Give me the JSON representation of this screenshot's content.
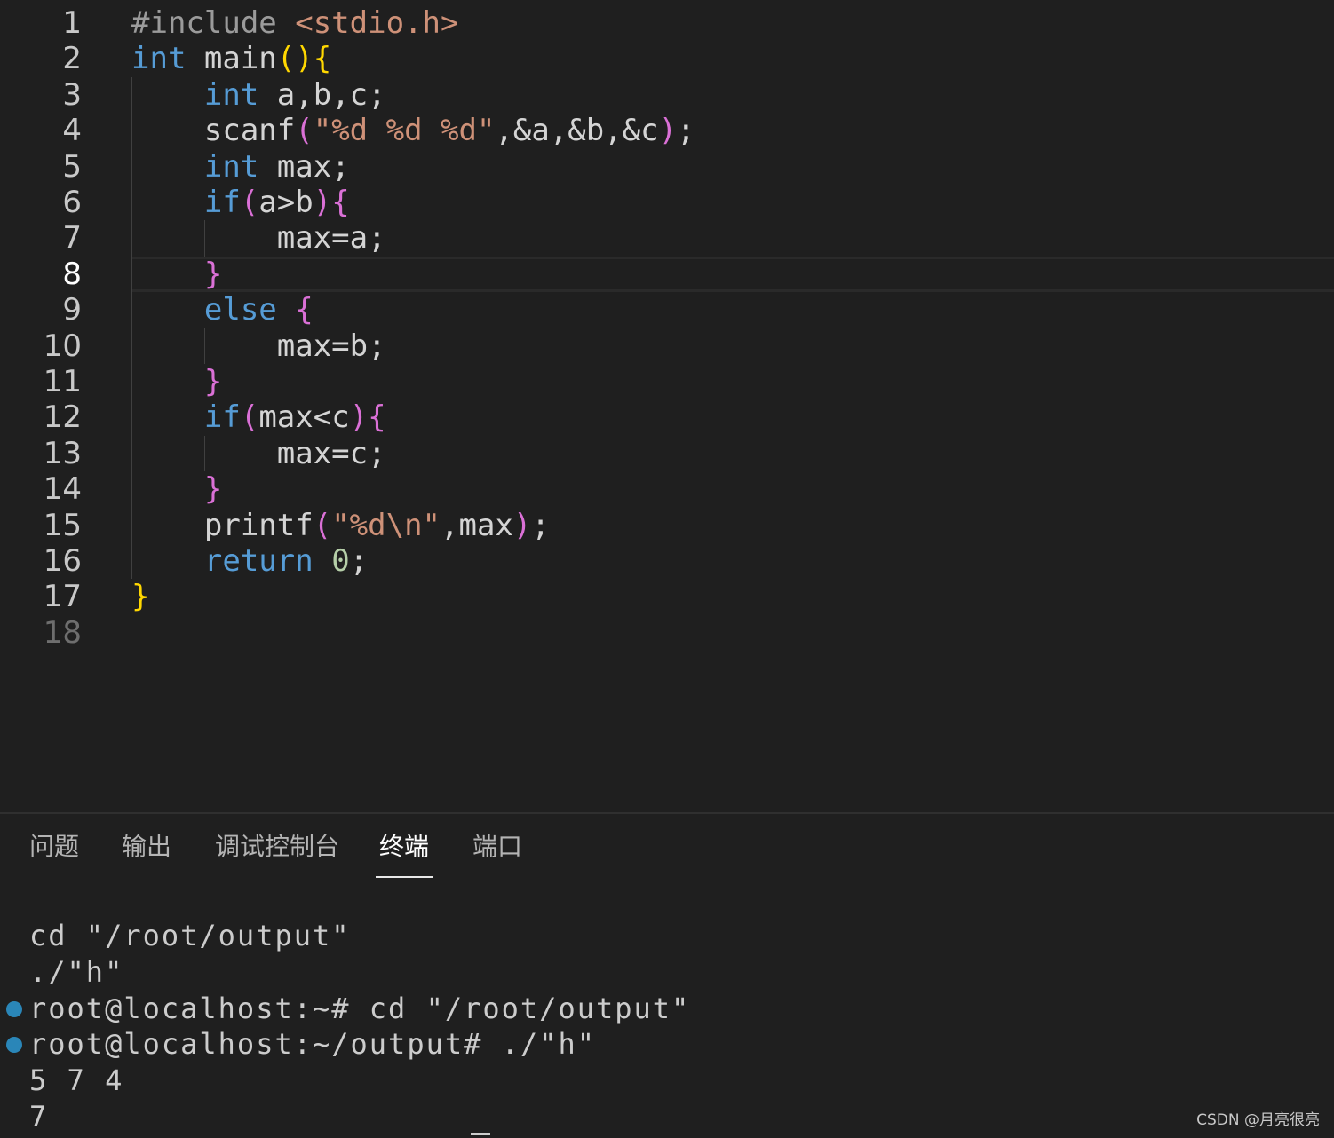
{
  "editor": {
    "lines": [
      {
        "num": "1",
        "tokens": [
          [
            "#include ",
            "pre"
          ],
          [
            "<stdio.h>",
            "str"
          ]
        ]
      },
      {
        "num": "2",
        "tokens": [
          [
            "int",
            "kw"
          ],
          [
            " main",
            "txt"
          ],
          [
            "()",
            "gold"
          ],
          [
            "{",
            "gold"
          ]
        ]
      },
      {
        "num": "3",
        "tokens": [
          [
            "    ",
            "txt"
          ],
          [
            "int",
            "kw"
          ],
          [
            " a,b,c;",
            "txt"
          ]
        ]
      },
      {
        "num": "4",
        "tokens": [
          [
            "    scanf",
            "txt"
          ],
          [
            "(",
            "pink"
          ],
          [
            "\"%d %d %d\"",
            "str"
          ],
          [
            ",&a,&b,&c",
            "txt"
          ],
          [
            ")",
            "pink"
          ],
          [
            ";",
            "txt"
          ]
        ]
      },
      {
        "num": "5",
        "tokens": [
          [
            "    ",
            "txt"
          ],
          [
            "int",
            "kw"
          ],
          [
            " max;",
            "txt"
          ]
        ]
      },
      {
        "num": "6",
        "tokens": [
          [
            "    ",
            "txt"
          ],
          [
            "if",
            "kw"
          ],
          [
            "(",
            "pink"
          ],
          [
            "a>b",
            "txt"
          ],
          [
            ")",
            "pink"
          ],
          [
            "{",
            "pink"
          ]
        ]
      },
      {
        "num": "7",
        "tokens": [
          [
            "        max=a;",
            "txt"
          ]
        ]
      },
      {
        "num": "8",
        "tokens": [
          [
            "    ",
            "txt"
          ],
          [
            "}",
            "pink"
          ]
        ]
      },
      {
        "num": "9",
        "tokens": [
          [
            "    ",
            "txt"
          ],
          [
            "else",
            "kw"
          ],
          [
            " ",
            "txt"
          ],
          [
            "{",
            "pink"
          ]
        ]
      },
      {
        "num": "10",
        "tokens": [
          [
            "        max=b;",
            "txt"
          ]
        ]
      },
      {
        "num": "11",
        "tokens": [
          [
            "    ",
            "txt"
          ],
          [
            "}",
            "pink"
          ]
        ]
      },
      {
        "num": "12",
        "tokens": [
          [
            "    ",
            "txt"
          ],
          [
            "if",
            "kw"
          ],
          [
            "(",
            "pink"
          ],
          [
            "max<c",
            "txt"
          ],
          [
            ")",
            "pink"
          ],
          [
            "{",
            "pink"
          ]
        ]
      },
      {
        "num": "13",
        "tokens": [
          [
            "        max=c;",
            "txt"
          ]
        ]
      },
      {
        "num": "14",
        "tokens": [
          [
            "    ",
            "txt"
          ],
          [
            "}",
            "pink"
          ]
        ]
      },
      {
        "num": "15",
        "tokens": [
          [
            "    printf",
            "txt"
          ],
          [
            "(",
            "pink"
          ],
          [
            "\"%d\\n\"",
            "str"
          ],
          [
            ",max",
            "txt"
          ],
          [
            ")",
            "pink"
          ],
          [
            ";",
            "txt"
          ]
        ]
      },
      {
        "num": "16",
        "tokens": [
          [
            "    ",
            "txt"
          ],
          [
            "return",
            "kw"
          ],
          [
            " ",
            "txt"
          ],
          [
            "0",
            "num"
          ],
          [
            ";",
            "txt"
          ]
        ]
      },
      {
        "num": "17",
        "tokens": [
          [
            "}",
            "gold"
          ]
        ]
      },
      {
        "num": "18",
        "tokens": []
      }
    ],
    "current_line": "8"
  },
  "panel": {
    "tabs": [
      {
        "label": "问题"
      },
      {
        "label": "输出"
      },
      {
        "label": "调试控制台"
      },
      {
        "label": "终端",
        "active": true
      },
      {
        "label": "端口"
      }
    ],
    "terminal": [
      {
        "text": "cd \"/root/output\"",
        "dot": false
      },
      {
        "text": "./\"h\"",
        "dot": false
      },
      {
        "text": "root@localhost:~# cd \"/root/output\"",
        "dot": true
      },
      {
        "text": "root@localhost:~/output# ./\"h\"",
        "dot": true
      },
      {
        "text": "5 7 4",
        "dot": false
      },
      {
        "text": "7",
        "dot": false
      }
    ]
  },
  "watermark": "CSDN @月亮很亮",
  "colors": {
    "background": "#1f1f1f",
    "keyword": "#569cd6",
    "string": "#ce9178",
    "bracket_gold": "#ffd700",
    "bracket_pink": "#da70d6",
    "number": "#b5cea8",
    "terminal_dot": "#2a86b8"
  }
}
